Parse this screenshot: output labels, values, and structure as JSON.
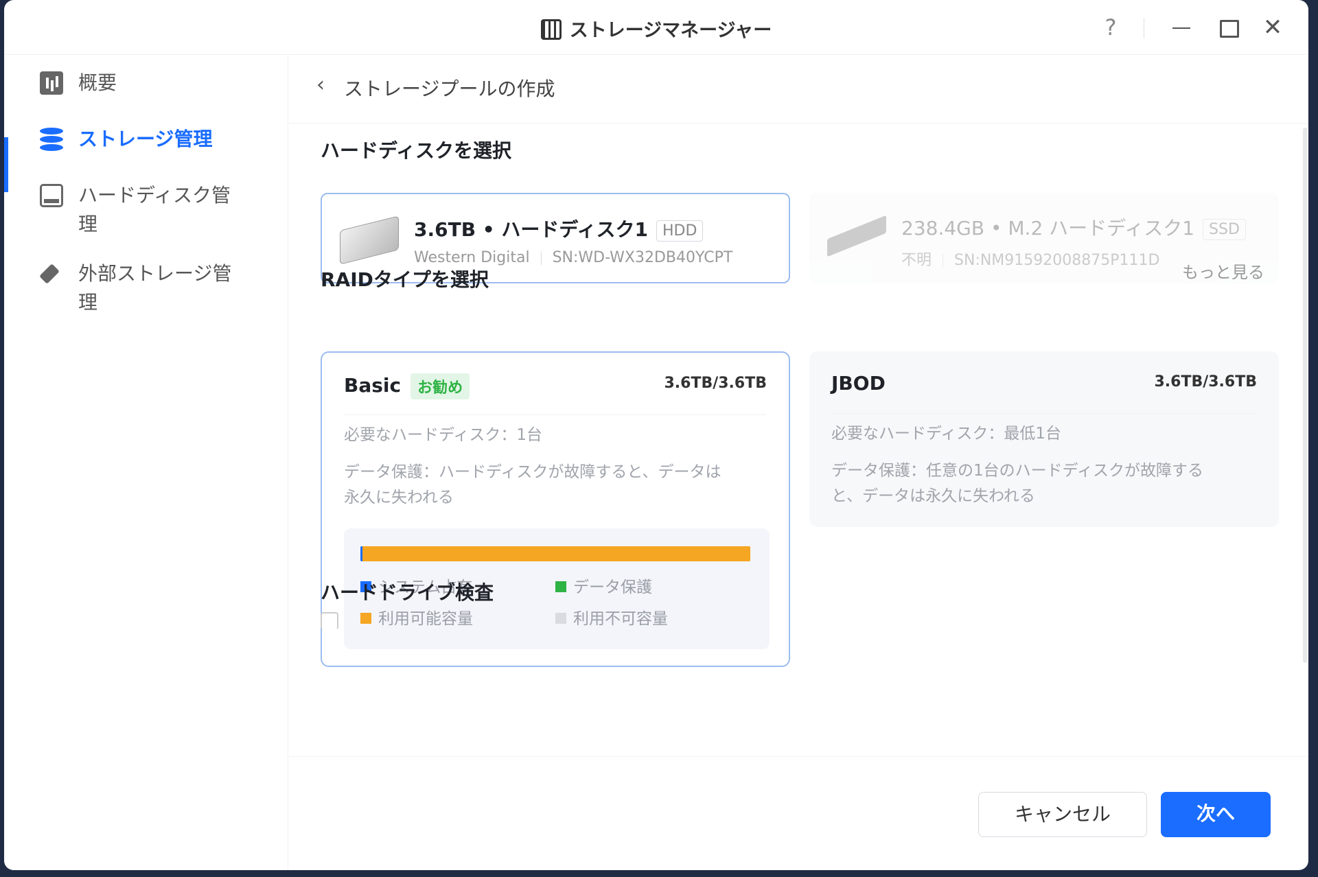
{
  "window": {
    "title": "ストレージマネージャー",
    "help_label": "?",
    "close_label": "✕"
  },
  "sidebar": {
    "items": [
      {
        "label": "概要",
        "icon": "overview-icon"
      },
      {
        "label": "ストレージ管理",
        "icon": "database-icon",
        "active": true
      },
      {
        "label": "ハードディスク管理",
        "icon": "hard-disk-icon"
      },
      {
        "label": "外部ストレージ管理",
        "icon": "external-drive-icon"
      }
    ]
  },
  "header": {
    "back_label": "‹",
    "title": "ストレージプールの作成"
  },
  "disks": {
    "section_title": "ハードディスクを選択",
    "items": [
      {
        "name": "3.6TB • ハードディスク1",
        "type": "HDD",
        "vendor": "Western Digital",
        "serial": "SN:WD-WX32DB40YCPT",
        "selected": true
      },
      {
        "name": "238.4GB • M.2 ハードディスク1",
        "type": "SSD",
        "vendor": "不明",
        "serial": "SN:NM91592008875P111D",
        "selected": false
      }
    ]
  },
  "raid": {
    "section_title": "RAIDタイプを選択",
    "more_label": "もっと見る",
    "options": [
      {
        "name": "Basic",
        "badge": "お勧め",
        "capacity": "3.6TB/3.6TB",
        "required": "必要なハードディスク：1台",
        "protection_1": "データ保護：ハードディスクが故障すると、データは",
        "protection_2": "永久に失われる"
      },
      {
        "name": "JBOD",
        "capacity": "3.6TB/3.6TB",
        "required": "必要なハードディスク：最低1台",
        "protection_1": "データ保護：任意の1台のハードディスクが故障する",
        "protection_2": "と、データは永久に失われる"
      }
    ],
    "usage": {
      "system_fraction": 0.005,
      "protection_fraction": 0.0,
      "available_fraction": 0.995,
      "legend": {
        "system": "システム占有",
        "protection": "データ保護",
        "available": "利用可能容量",
        "unavailable": "利用不可容量"
      },
      "colors": {
        "system": "#1a6dff",
        "protection": "#2fb344",
        "available": "#f5a623",
        "unavailable": "#d9dbe0"
      }
    }
  },
  "check": {
    "section_title": "ハードドライブ検査"
  },
  "footer": {
    "cancel_label": "キャンセル",
    "next_label": "次へ"
  },
  "colors": {
    "accent": "#1a6dff",
    "selected_border": "#9bbcf0",
    "recommend": "#2fb344"
  }
}
